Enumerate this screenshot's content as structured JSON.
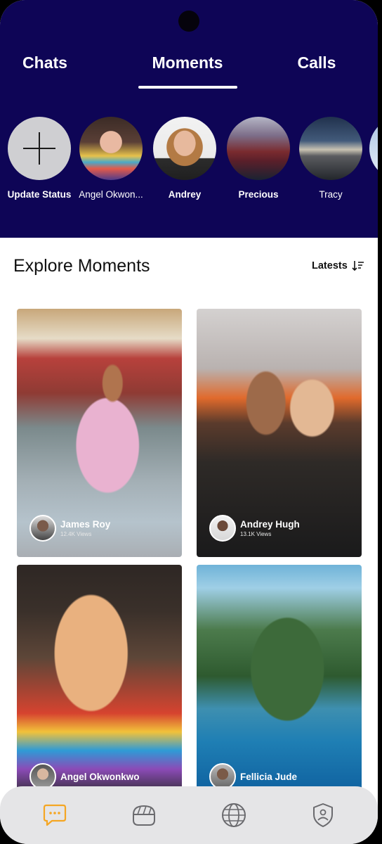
{
  "tabs": [
    {
      "label": "Chats"
    },
    {
      "label": "Moments",
      "active": true
    },
    {
      "label": "Calls"
    }
  ],
  "statuses": [
    {
      "name": "Update Status",
      "type": "add"
    },
    {
      "name": "Angel Okwon..."
    },
    {
      "name": "Andrey"
    },
    {
      "name": "Precious"
    },
    {
      "name": "Tracy"
    }
  ],
  "explore": {
    "title": "Explore Moments",
    "sort_label": "Latests"
  },
  "moments": [
    {
      "owner": "James Roy",
      "views": "12.4K Views"
    },
    {
      "owner": "Andrey Hugh",
      "views": "13.1K Views"
    },
    {
      "owner": "Angel Okwonkwo"
    },
    {
      "owner": "Fellicia Jude"
    }
  ],
  "nav": [
    {
      "icon": "chat-bubble-icon",
      "active": true
    },
    {
      "icon": "bowl-icon"
    },
    {
      "icon": "globe-icon"
    },
    {
      "icon": "shield-user-icon"
    }
  ],
  "colors": {
    "header_bg": "#0e0556",
    "accent": "#f5a623",
    "nav_bg": "#e5e5e7"
  }
}
